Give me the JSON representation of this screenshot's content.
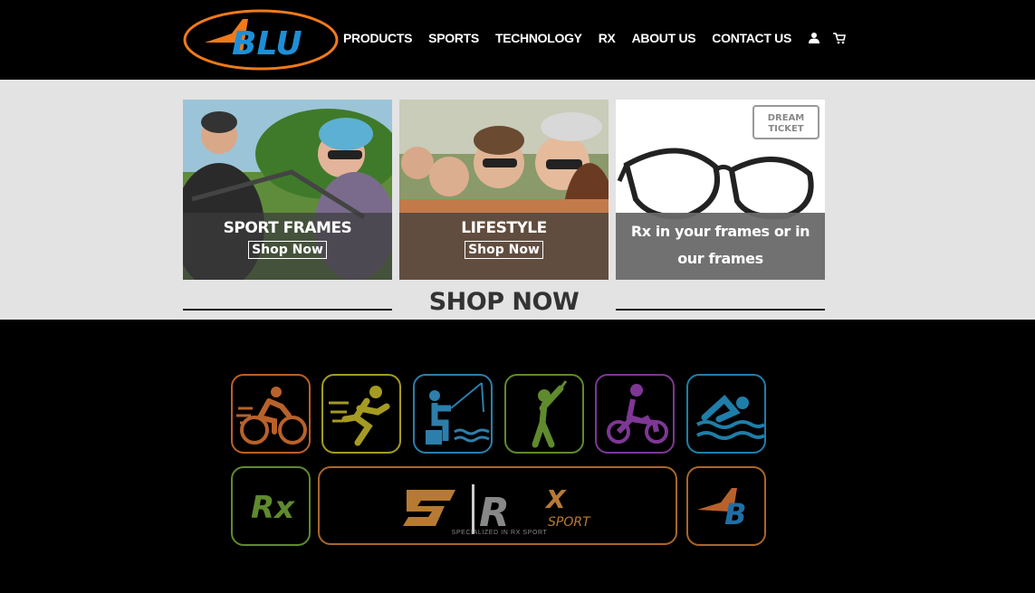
{
  "header": {
    "logo_text": "BLU",
    "nav": [
      "PRODUCTS",
      "SPORTS",
      "TECHNOLOGY",
      "RX",
      "ABOUT US",
      "CONTACT US"
    ],
    "account_icon": "person-icon",
    "cart_icon": "cart-icon"
  },
  "tiles": [
    {
      "title": "SPORT FRAMES",
      "button": "Shop Now"
    },
    {
      "title": "LIFESTYLE",
      "button": "Shop Now"
    },
    {
      "title": "Rx in your frames or in our frames",
      "badge": "DREAM TICKET"
    }
  ],
  "shop_heading": "SHOP NOW",
  "sport_icons": [
    {
      "name": "cycling",
      "color": "#b9612a"
    },
    {
      "name": "running",
      "color": "#a59b22"
    },
    {
      "name": "fishing",
      "color": "#2d7eab"
    },
    {
      "name": "golf",
      "color": "#5f8a2d"
    },
    {
      "name": "motocross",
      "color": "#7e3795"
    },
    {
      "name": "swimming",
      "color": "#1f7ea9"
    }
  ],
  "rx_label": "Rx",
  "srx": {
    "s": "S",
    "r": "R",
    "x": "X",
    "sport": "SPORT",
    "tagline": "SPECIALIZED IN RX SPORT"
  },
  "colors": {
    "brand_blue": "#1e8fd6",
    "brand_orange": "#f07a1a",
    "band": "#e3e3e3"
  }
}
